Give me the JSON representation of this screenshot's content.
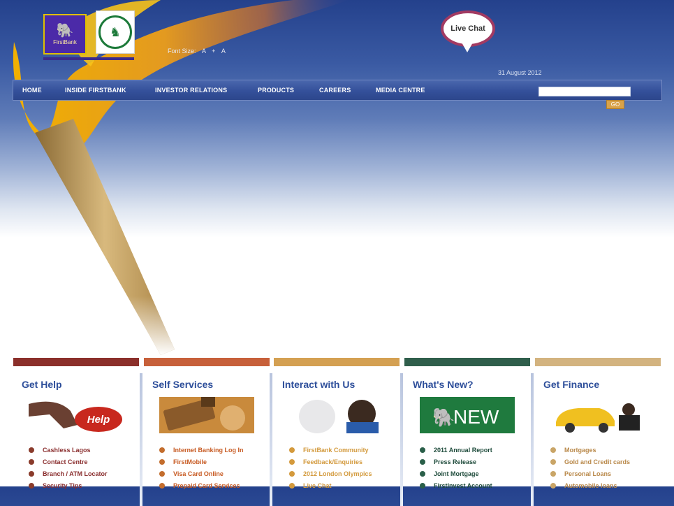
{
  "header": {
    "logo_text": "FirstBank",
    "font_size_label": "Font Size:",
    "font_size_options": [
      "A",
      "+",
      "A"
    ],
    "live_chat_label": "Live Chat",
    "date_text": "31 August 2012"
  },
  "nav": {
    "items": [
      "HOME",
      "INSIDE FIRSTBANK",
      "INVESTOR RELATIONS",
      "PRODUCTS",
      "CAREERS",
      "MEDIA CENTRE"
    ],
    "search_value": "",
    "search_button": "GO"
  },
  "columns": [
    {
      "title": "Get Help",
      "bar_color": "#8b2f2a",
      "bullet_color": "#8a3b2b",
      "link_color": "#8a2e2e",
      "links": [
        "Cashless Lagos",
        "Contact Centre",
        "Branch / ATM Locator",
        "Security Tips"
      ]
    },
    {
      "title": "Self Services",
      "bar_color": "#c7603a",
      "bullet_color": "#c36d2d",
      "link_color": "#c75a22",
      "links": [
        "Internet Banking Log In",
        "FirstMobile",
        "Visa Card Online",
        "Prepaid Card Services"
      ]
    },
    {
      "title": "Interact with Us",
      "bar_color": "#d4a052",
      "bullet_color": "#d49a3c",
      "link_color": "#d39a3d",
      "links": [
        "FirstBank Community",
        "Feedback/Enquiries",
        "2012 London Olympics",
        "Live Chat"
      ]
    },
    {
      "title": "What's New?",
      "bar_color": "#2f5e4b",
      "bullet_color": "#2a5f49",
      "link_color": "#1e4b3b",
      "links": [
        "2011 Annual Report",
        "Press Release",
        "Joint Mortgage",
        "FirstInvest Account"
      ]
    },
    {
      "title": "Get Finance",
      "bar_color": "#d3b37f",
      "bullet_color": "#c9a567",
      "link_color": "#b9894a",
      "links": [
        "Mortgages",
        "Gold and Credit cards",
        "Personal Loans",
        "Automobile loans"
      ]
    }
  ],
  "images": {
    "help_word": "Help",
    "new_word": "NEW"
  }
}
